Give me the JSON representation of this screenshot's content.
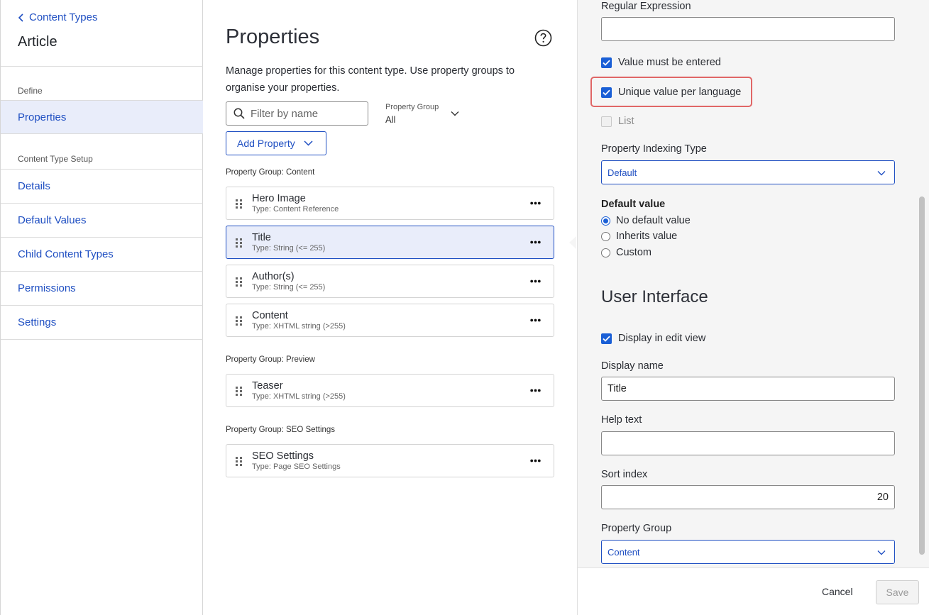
{
  "sidebar": {
    "back_label": "Content Types",
    "title": "Article",
    "section_define": "Define",
    "section_setup": "Content Type Setup",
    "items": [
      {
        "label": "Properties"
      },
      {
        "label": "Details"
      },
      {
        "label": "Default Values"
      },
      {
        "label": "Child Content Types"
      },
      {
        "label": "Permissions"
      },
      {
        "label": "Settings"
      }
    ]
  },
  "main": {
    "title": "Properties",
    "description": "Manage properties for this content type. Use property groups to organise your properties.",
    "filter_placeholder": "Filter by name",
    "property_group_label": "Property Group",
    "property_group_value": "All",
    "add_property_label": "Add Property",
    "groups": [
      {
        "label": "Property Group: Content",
        "properties": [
          {
            "name": "Hero Image",
            "type": "Type: Content Reference"
          },
          {
            "name": "Title",
            "type": "Type: String (<= 255)"
          },
          {
            "name": "Author(s)",
            "type": "Type: String (<= 255)"
          },
          {
            "name": "Content",
            "type": "Type: XHTML string (>255)"
          }
        ]
      },
      {
        "label": "Property Group: Preview",
        "properties": [
          {
            "name": "Teaser",
            "type": "Type: XHTML string (>255)"
          }
        ]
      },
      {
        "label": "Property Group: SEO Settings",
        "properties": [
          {
            "name": "SEO Settings",
            "type": "Type: Page SEO Settings"
          }
        ]
      }
    ]
  },
  "panel": {
    "regex_label": "Regular Expression",
    "regex_value": "",
    "value_required_label": "Value must be entered",
    "unique_label": "Unique value per language",
    "list_label": "List",
    "indexing_label": "Property Indexing Type",
    "indexing_value": "Default",
    "default_value_label": "Default value",
    "default_options": [
      "No default value",
      "Inherits value",
      "Custom"
    ],
    "ui_title": "User Interface",
    "display_in_edit_label": "Display in edit view",
    "display_name_label": "Display name",
    "display_name_value": "Title",
    "help_text_label": "Help text",
    "help_text_value": "",
    "sort_index_label": "Sort index",
    "sort_index_value": "20",
    "property_group_label": "Property Group",
    "property_group_value": "Content",
    "cancel_label": "Cancel",
    "save_label": "Save"
  },
  "colors": {
    "link": "#1f4fc2",
    "checkbox": "#1a5fd6",
    "highlight": "#e06666",
    "selected_bg": "#e9edfa"
  }
}
